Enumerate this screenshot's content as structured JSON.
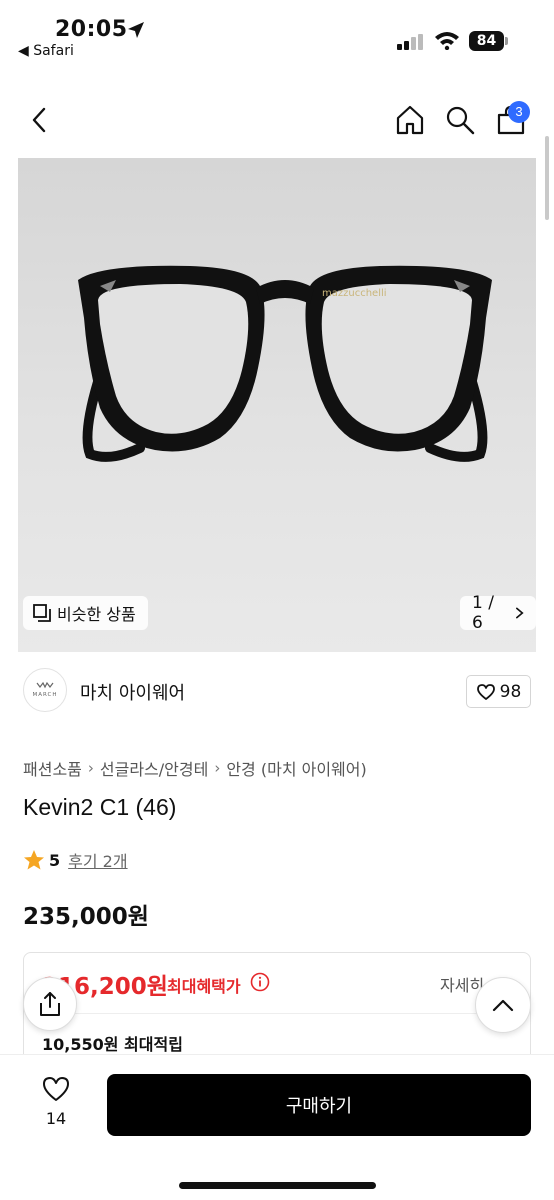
{
  "status_bar": {
    "time": "20:05",
    "back_app": "◀ Safari",
    "battery": "84"
  },
  "nav": {
    "cart_count": "3"
  },
  "gallery": {
    "frame_brand": "mazzucchelli",
    "similar_label": "비슷한 상품",
    "pager": "1 / 6"
  },
  "shop": {
    "logo_text": "MARCH",
    "name": "마치 아이웨어",
    "like_count": "98"
  },
  "breadcrumb": {
    "items": [
      "패션소품",
      "선글라스/안경테",
      "안경 (마치 아이웨어)"
    ]
  },
  "product": {
    "title": "Kevin2 C1 (46)",
    "rating": "5",
    "reviews": "후기 2개",
    "price": "235,000원"
  },
  "benefit": {
    "best_price": "216,200원",
    "best_label": "최대혜택가",
    "detail_link": "자세히",
    "points": "10,550원 최대적립"
  },
  "bottom_bar": {
    "wish_count": "14",
    "buy_label": "구매하기"
  },
  "colors": {
    "accent_red": "#e5292c",
    "badge_blue": "#2f6bff",
    "buy_button": "#000000",
    "star": "#f5a623"
  }
}
